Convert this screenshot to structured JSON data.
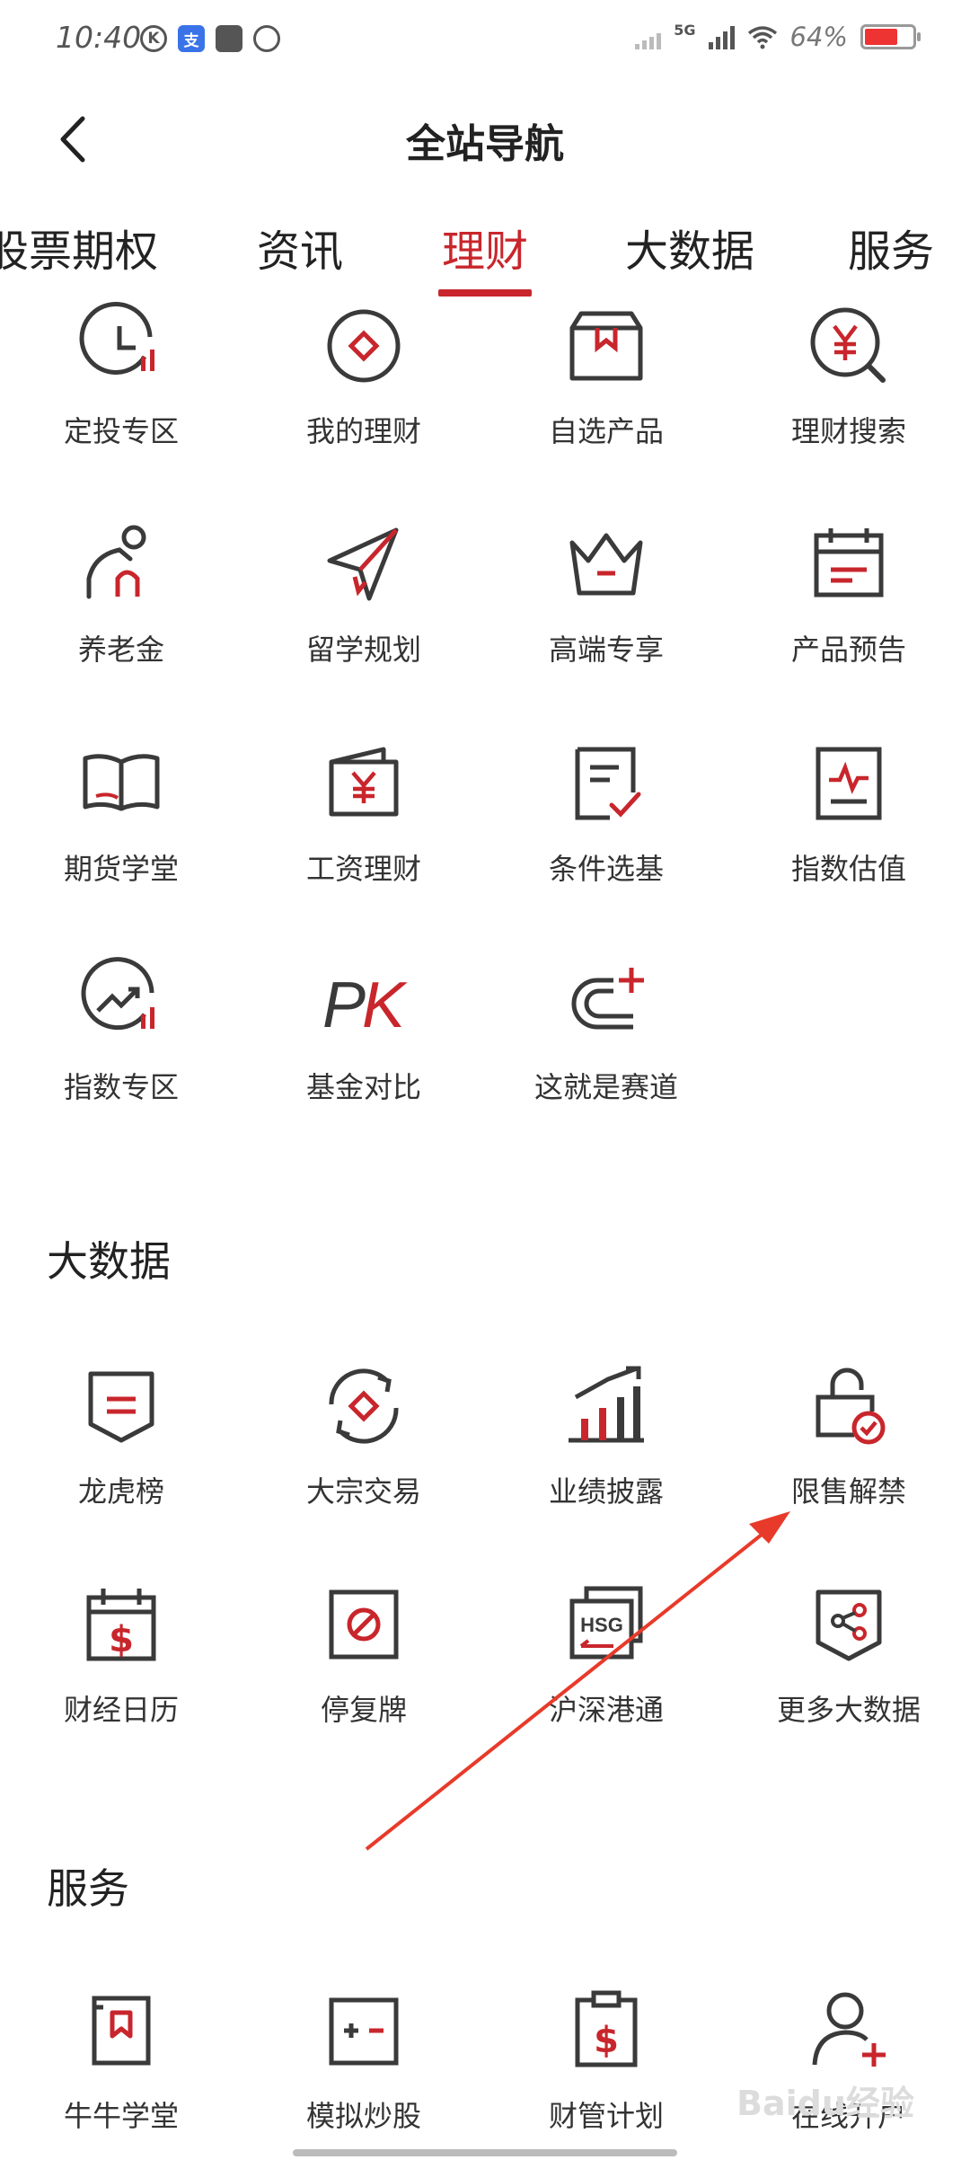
{
  "status_bar": {
    "time": "10:40",
    "network": "5G",
    "battery": "64%",
    "battery_level": 0.64,
    "left_icons": [
      "k-icon",
      "alipay-icon",
      "media-icon",
      "app-icon"
    ]
  },
  "header": {
    "title": "全站导航",
    "back_icon": "chevron-left-icon"
  },
  "tabs": [
    {
      "label": "股票期权",
      "active": false
    },
    {
      "label": "资讯",
      "active": false
    },
    {
      "label": "理财",
      "active": true
    },
    {
      "label": "大数据",
      "active": false
    },
    {
      "label": "服务",
      "active": false
    }
  ],
  "licai": {
    "items": [
      {
        "label": "定投专区",
        "icon": "clock-chart-icon"
      },
      {
        "label": "我的理财",
        "icon": "diamond-circle-icon"
      },
      {
        "label": "自选产品",
        "icon": "box-bookmark-icon"
      },
      {
        "label": "理财搜索",
        "icon": "yuan-search-icon"
      },
      {
        "label": "养老金",
        "icon": "elder-icon"
      },
      {
        "label": "留学规划",
        "icon": "paper-plane-icon"
      },
      {
        "label": "高端专享",
        "icon": "crown-icon"
      },
      {
        "label": "产品预告",
        "icon": "calendar-icon"
      },
      {
        "label": "期货学堂",
        "icon": "book-icon"
      },
      {
        "label": "工资理财",
        "icon": "wallet-yuan-icon"
      },
      {
        "label": "条件选基",
        "icon": "checklist-icon"
      },
      {
        "label": "指数估值",
        "icon": "pulse-chart-icon"
      },
      {
        "label": "指数专区",
        "icon": "trend-circle-icon"
      },
      {
        "label": "基金对比",
        "icon": "pk-icon"
      },
      {
        "label": "这就是赛道",
        "icon": "track-plus-icon"
      }
    ]
  },
  "bigdata": {
    "title": "大数据",
    "items": [
      {
        "label": "龙虎榜",
        "icon": "shield-list-icon"
      },
      {
        "label": "大宗交易",
        "icon": "exchange-diamond-icon"
      },
      {
        "label": "业绩披露",
        "icon": "bar-chart-arrow-icon"
      },
      {
        "label": "限售解禁",
        "icon": "unlock-check-icon"
      },
      {
        "label": "财经日历",
        "icon": "dollar-calendar-icon"
      },
      {
        "label": "停复牌",
        "icon": "stop-square-icon"
      },
      {
        "label": "沪深港通",
        "icon": "hsg-icon"
      },
      {
        "label": "更多大数据",
        "icon": "shield-share-icon"
      }
    ]
  },
  "services": {
    "title": "服务",
    "items": [
      {
        "label": "牛牛学堂",
        "icon": "bookmark-book-icon"
      },
      {
        "label": "模拟炒股",
        "icon": "plus-minus-icon"
      },
      {
        "label": "财管计划",
        "icon": "clipboard-dollar-icon"
      },
      {
        "label": "在线开户",
        "icon": "user-plus-icon"
      }
    ]
  },
  "watermark": "Baidu经验",
  "colors": {
    "accent": "#c8262c",
    "icon_dark": "#3a3a3a",
    "text": "#333333",
    "arrow": "#e83a2a"
  }
}
